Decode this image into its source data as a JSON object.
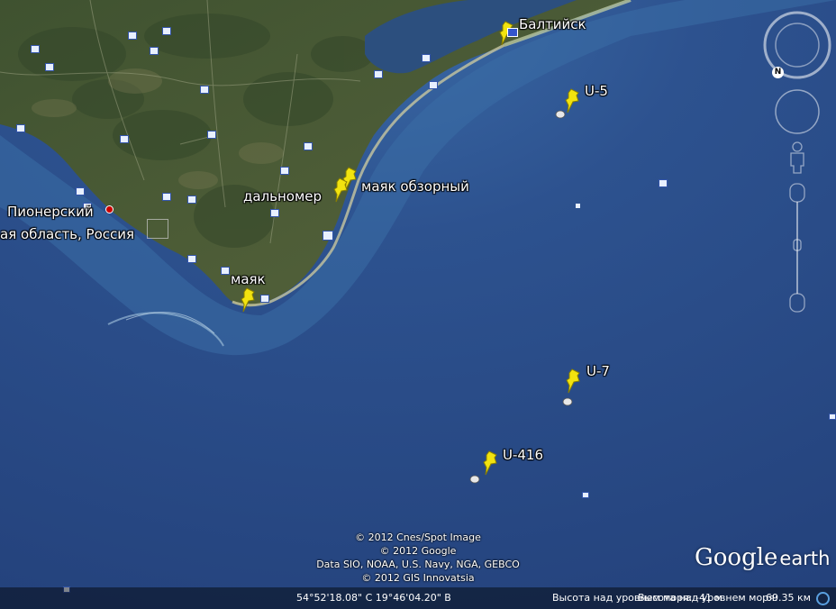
{
  "labels": {
    "baltiysk": "Балтийск",
    "u5": "U-5",
    "mayak_obzorny": "маяк обзорный",
    "dalnomer": "дальномер",
    "pionersky": "Пионерский",
    "region": "ая область, Россия",
    "mayak": "маяк",
    "u7": "U-7",
    "u416": "U-416"
  },
  "credits": [
    "© 2012 Cnes/Spot Image",
    "© 2012 Google",
    "Data SIO, NOAA, U.S. Navy, NGA, GEBCO",
    "© 2012 GIS Innovatsia"
  ],
  "logo": {
    "google": "Google",
    "earth": "earth"
  },
  "status": {
    "coords": "54°52'18.08\" С  19°46'04.20\" В",
    "elevation": "Высота над уровнем моря: -41 м",
    "eye_alt_label": "Высота над уровнем моря:",
    "eye_alt_value": "69.35 км"
  },
  "nav_controls": {
    "north_label": "N"
  },
  "colors": {
    "sea": "#2d4d88",
    "land": "#4a5a34",
    "pin": "#f2e30f",
    "label_text": "#ffffff"
  },
  "icons": [
    "pushpin-icon",
    "submarine-marker-icon",
    "poi-icon",
    "compass-icon",
    "look-joystick-icon",
    "street-view-icon",
    "zoom-slider-icon"
  ]
}
